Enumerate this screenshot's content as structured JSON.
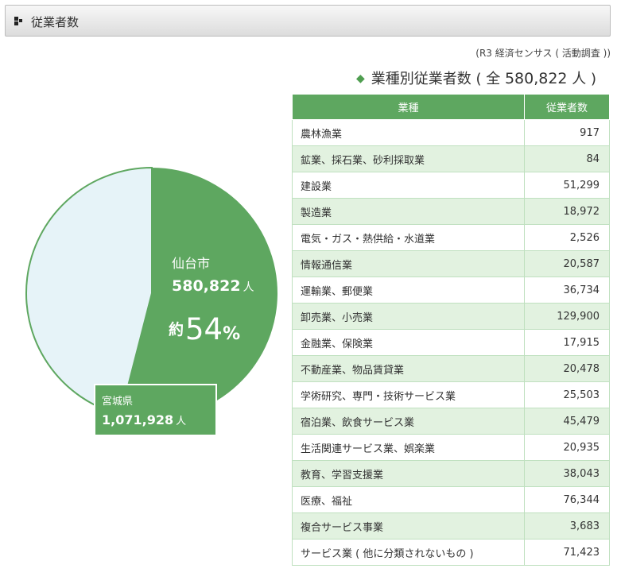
{
  "header": {
    "title": "従業者数"
  },
  "source_note": "(R3 経済センサス ( 活動調査 ))",
  "table_title": {
    "prefix": "業種別従業者数 ( 全",
    "total": "580,822",
    "suffix": "人 )"
  },
  "pie_labels": {
    "sendai_name": "仙台市",
    "sendai_count": "580,822",
    "sendai_unit": "人",
    "pct_prefix": "約",
    "pct_value": "54",
    "pct_sign": "%",
    "miyagi_name": "宮城県",
    "miyagi_count": "1,071,928",
    "miyagi_unit": "人"
  },
  "colors": {
    "sendai": "#5ea760",
    "miyagi": "#e6f3f8",
    "row_alt": "#e2f2e0"
  },
  "chart_data": [
    {
      "type": "pie",
      "slices": [
        {
          "name": "仙台市",
          "value": 580822,
          "percent": 54
        },
        {
          "name": "宮城県",
          "value": 1071928
        }
      ],
      "title": ""
    },
    {
      "type": "table",
      "title": "業種別従業者数 ( 全 580,822 人 )",
      "columns": [
        "業種",
        "従業者数"
      ],
      "rows": [
        [
          "農林漁業",
          "917"
        ],
        [
          "鉱業、採石業、砂利採取業",
          "84"
        ],
        [
          "建設業",
          "51,299"
        ],
        [
          "製造業",
          "18,972"
        ],
        [
          "電気・ガス・熱供給・水道業",
          "2,526"
        ],
        [
          "情報通信業",
          "20,587"
        ],
        [
          "運輸業、郵便業",
          "36,734"
        ],
        [
          "卸売業、小売業",
          "129,900"
        ],
        [
          "金融業、保険業",
          "17,915"
        ],
        [
          "不動産業、物品賃貸業",
          "20,478"
        ],
        [
          "学術研究、専門・技術サービス業",
          "25,503"
        ],
        [
          "宿泊業、飲食サービス業",
          "45,479"
        ],
        [
          "生活関連サービス業、娯楽業",
          "20,935"
        ],
        [
          "教育、学習支援業",
          "38,043"
        ],
        [
          "医療、福祉",
          "76,344"
        ],
        [
          "複合サービス事業",
          "3,683"
        ],
        [
          "サービス業 ( 他に分類されないもの )",
          "71,423"
        ]
      ]
    }
  ]
}
